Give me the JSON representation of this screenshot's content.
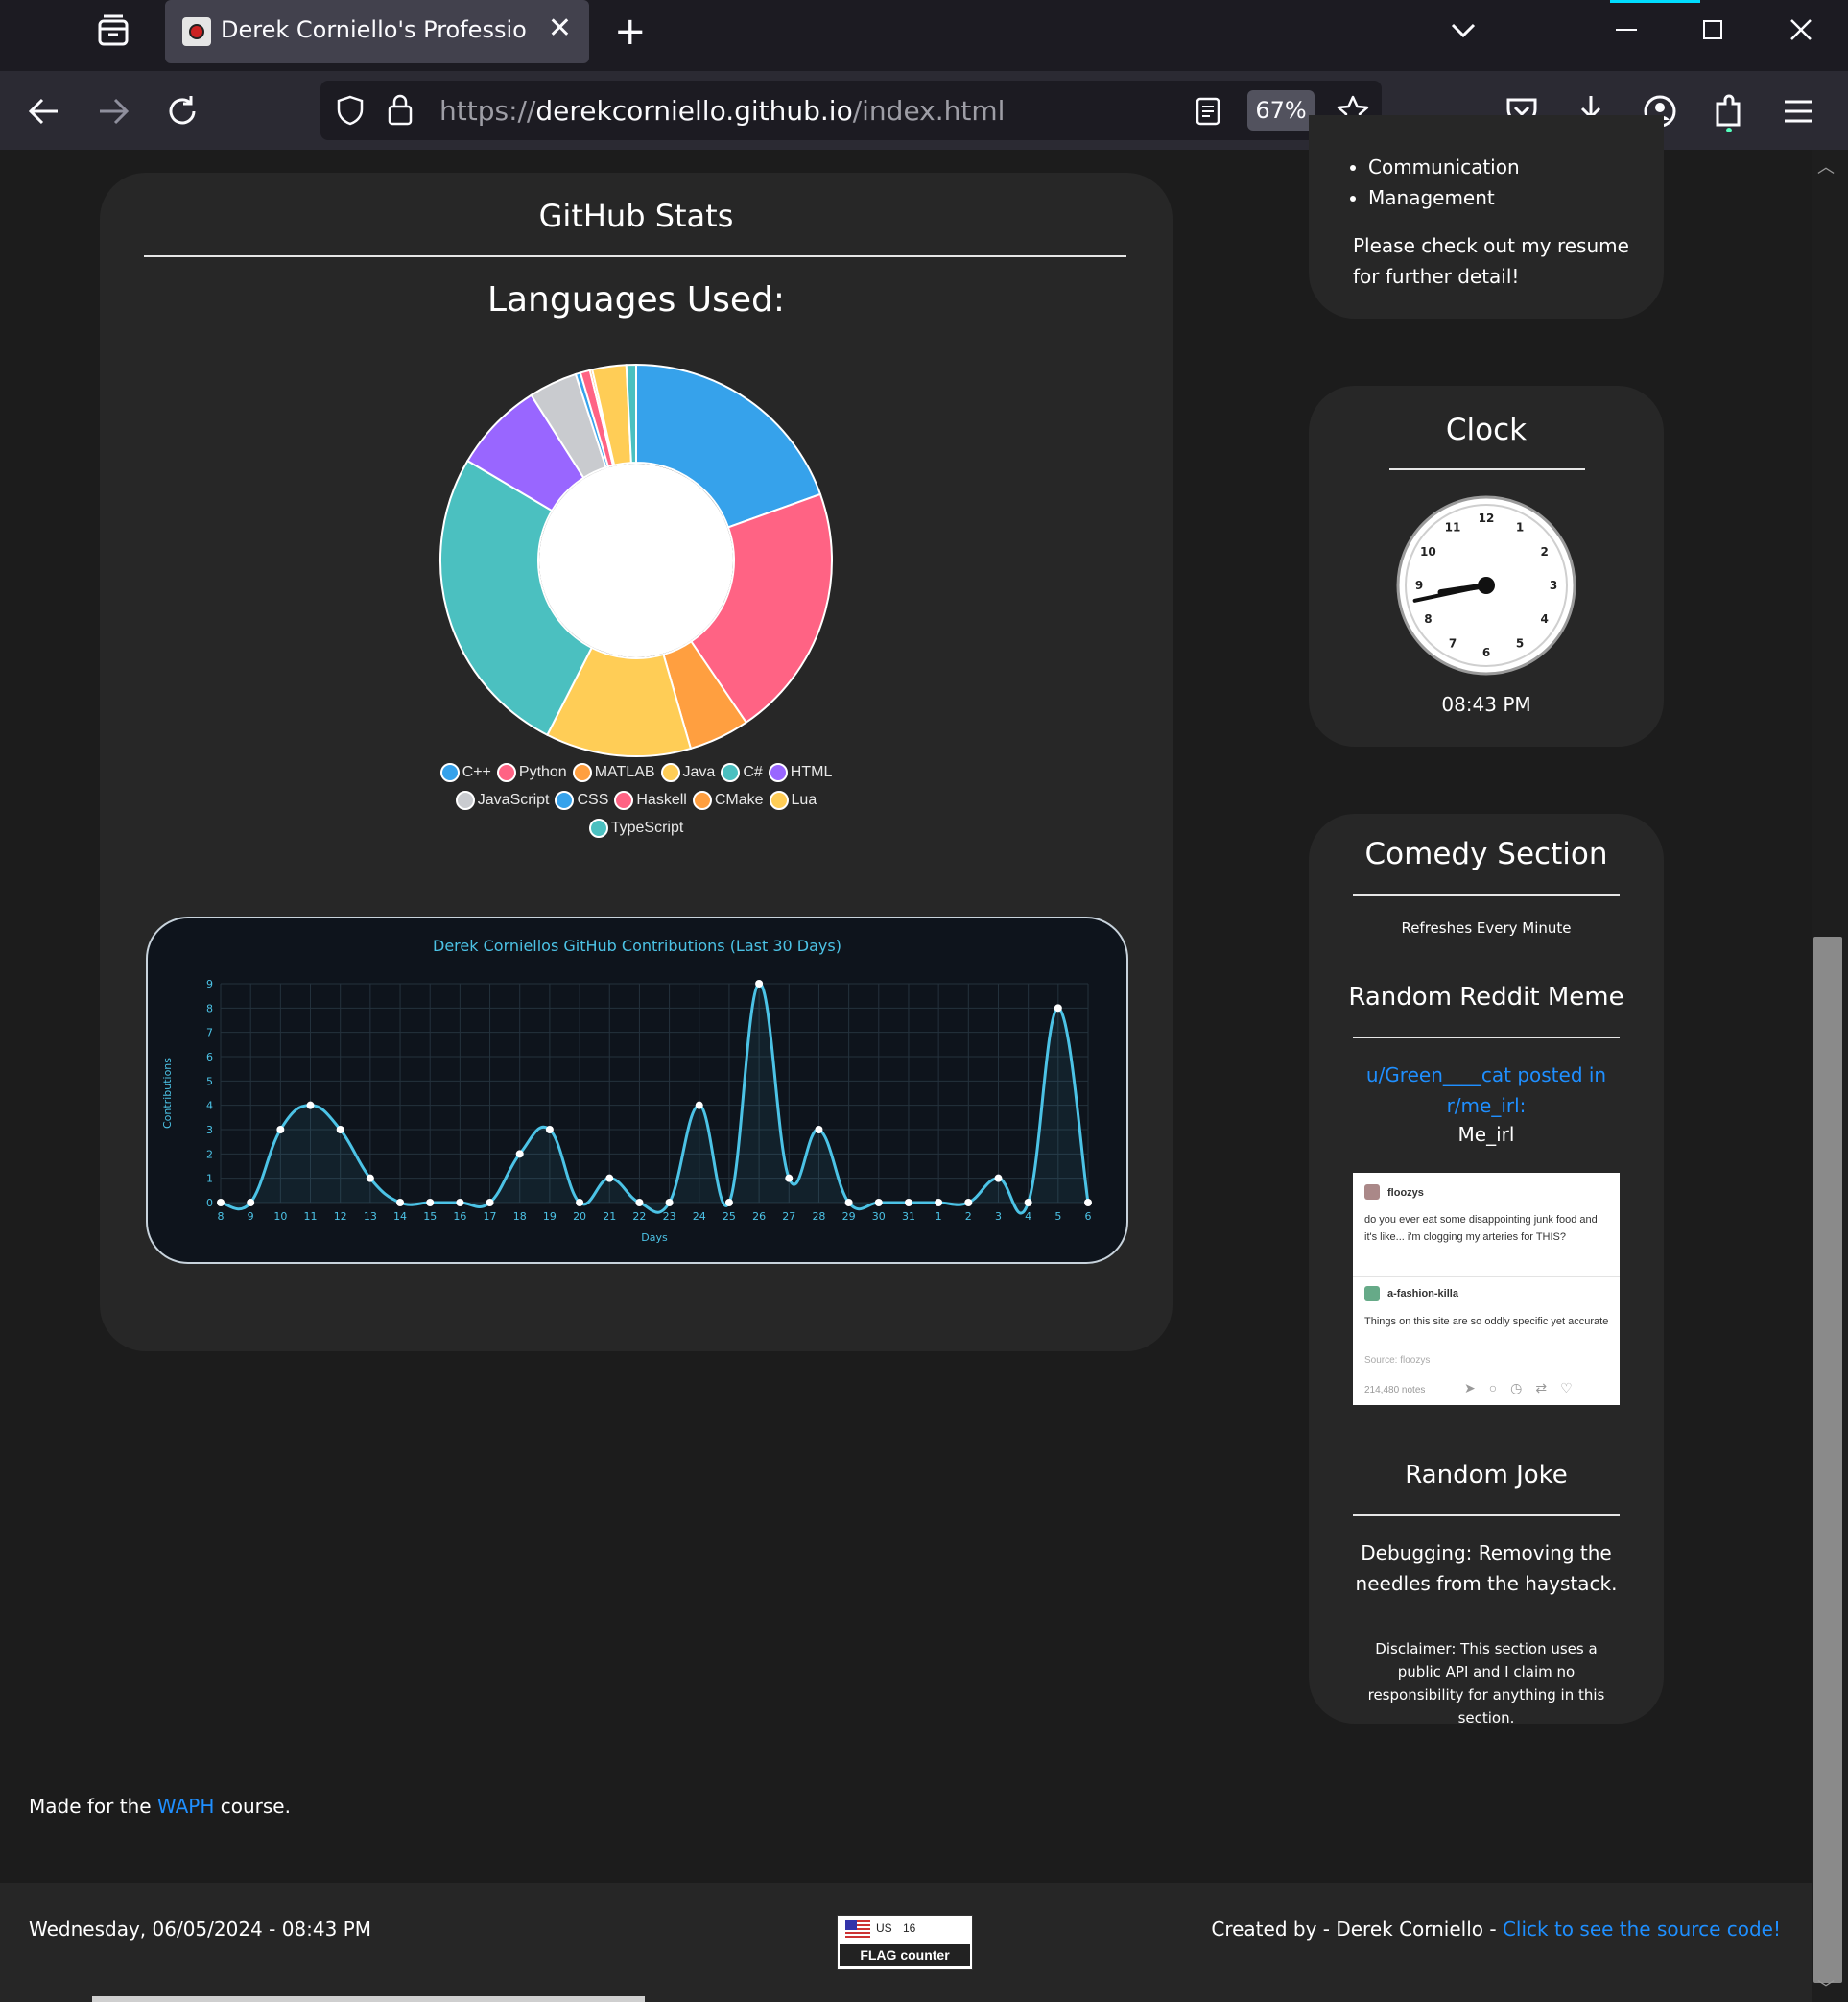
{
  "browser": {
    "tab_title": "Derek Corniello's Professional Web",
    "url_scheme": "https://",
    "url_host": "derekcorniello.github.io",
    "url_path": "/index.html",
    "zoom": "67%"
  },
  "github_stats": {
    "heading": "GitHub Stats",
    "languages_heading": "Languages Used:"
  },
  "skills_card": {
    "items": [
      "Communication",
      "Management"
    ],
    "note": "Please check out my resume for further detail!"
  },
  "clock": {
    "heading": "Clock",
    "time": "08:43 PM",
    "numbers": [
      "12",
      "1",
      "2",
      "3",
      "4",
      "5",
      "6",
      "7",
      "8",
      "9",
      "10",
      "11"
    ]
  },
  "comedy": {
    "heading": "Comedy Section",
    "refresh": "Refreshes Every Minute",
    "meme_heading": "Random Reddit Meme",
    "meme_author_link": "u/Green____cat posted in r/me_irl:",
    "meme_title": "Me_irl",
    "meme": {
      "user1": "floozys",
      "text1": "do you ever eat some disappointing junk food and it's like... i'm clogging my arteries for THIS?",
      "user2": "a-fashion-killa",
      "text2": "Things on this site are so oddly specific yet accurate",
      "source": "Source: floozys",
      "notes": "214,480 notes"
    },
    "joke_heading": "Random Joke",
    "joke": "Debugging: Removing the needles from the haystack.",
    "disclaimer": "Disclaimer: This section uses a public API and I claim no responsibility for anything in this section."
  },
  "made_for": {
    "prefix": "Made for the ",
    "link": "WAPH",
    "suffix": " course."
  },
  "footer": {
    "datetime": "Wednesday, 06/05/2024 - 08:43 PM",
    "flag_country": "US",
    "flag_count": "16",
    "flag_brand": "FLAG counter",
    "created_by": "Created by - Derek Corniello - ",
    "source_link": "Click to see the source code!"
  },
  "chart_data": [
    {
      "type": "pie",
      "title": "",
      "donut": true,
      "legend_position": "bottom",
      "categories": [
        "C++",
        "Python",
        "MATLAB",
        "Java",
        "C#",
        "HTML",
        "JavaScript",
        "CSS",
        "Haskell",
        "CMake",
        "Lua",
        "TypeScript"
      ],
      "values": [
        19.5,
        21.0,
        5.0,
        12.0,
        26.0,
        7.5,
        4.0,
        0.4,
        0.8,
        0.2,
        2.8,
        0.8
      ],
      "colors": [
        "#36a2eb",
        "#ff6384",
        "#ff9f40",
        "#ffcd56",
        "#4bc0c0",
        "#9966ff",
        "#c9cbcf",
        "#36a2eb",
        "#ff6384",
        "#ff9f40",
        "#ffcd56",
        "#4bc0c0"
      ]
    },
    {
      "type": "line",
      "title": "Derek Corniellos GitHub Contributions (Last 30 Days)",
      "xlabel": "Days",
      "ylabel": "Contributions",
      "ylim": [
        0,
        9
      ],
      "yticks": [
        "0",
        "1",
        "2",
        "3",
        "4",
        "5",
        "6",
        "7",
        "8",
        "9"
      ],
      "grid": true,
      "x": [
        "8",
        "9",
        "10",
        "11",
        "12",
        "13",
        "14",
        "15",
        "16",
        "17",
        "18",
        "19",
        "20",
        "21",
        "22",
        "23",
        "24",
        "25",
        "26",
        "27",
        "28",
        "29",
        "30",
        "31",
        "1",
        "2",
        "3",
        "4",
        "5",
        "6"
      ],
      "series": [
        {
          "values": [
            0,
            0,
            3,
            4,
            3,
            1,
            0,
            0,
            0,
            0,
            2,
            3,
            0,
            1,
            0,
            0,
            4,
            0,
            9,
            1,
            3,
            0,
            0,
            0,
            0,
            0,
            1,
            0,
            8,
            0
          ]
        }
      ],
      "color": "#4cc3e6"
    }
  ]
}
